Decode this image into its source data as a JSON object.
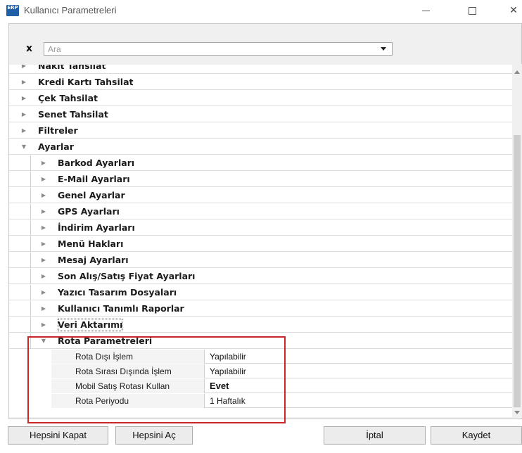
{
  "window": {
    "title": "Kullanıcı Parametreleri",
    "icon_name": "app-logo-icon",
    "icon_text": "ERP"
  },
  "filter": {
    "clear_symbol": "x",
    "search_placeholder": "Ara",
    "search_value": ""
  },
  "tree": {
    "top_items": [
      {
        "label": "Nakit Tahsilat",
        "expanded": false
      },
      {
        "label": "Kredi Kartı Tahsilat",
        "expanded": false
      },
      {
        "label": "Çek Tahsilat",
        "expanded": false
      },
      {
        "label": "Senet Tahsilat",
        "expanded": false
      },
      {
        "label": "Filtreler",
        "expanded": false
      },
      {
        "label": "Ayarlar",
        "expanded": true
      }
    ],
    "ayarlar_children": [
      {
        "label": "Barkod Ayarları"
      },
      {
        "label": "E-Mail Ayarları"
      },
      {
        "label": "Genel Ayarlar"
      },
      {
        "label": "GPS Ayarları"
      },
      {
        "label": "İndirim Ayarları"
      },
      {
        "label": "Menü Hakları"
      },
      {
        "label": "Mesaj Ayarları"
      },
      {
        "label": "Son Alış/Satış Fiyat Ayarları"
      },
      {
        "label": "Yazıcı Tasarım Dosyaları"
      },
      {
        "label": "Kullanıcı Tanımlı Raporlar"
      },
      {
        "label": "Veri Aktarımı"
      },
      {
        "label": "Rota Parametreleri",
        "expanded": true
      }
    ],
    "rota_params": [
      {
        "name": "Rota Dışı İşlem",
        "value": "Yapılabilir"
      },
      {
        "name": "Rota Sırası Dışında İşlem",
        "value": "Yapılabilir"
      },
      {
        "name": "Mobil Satış Rotası Kullan",
        "value": "Evet"
      },
      {
        "name": "Rota Periyodu",
        "value": "1 Haftalık"
      }
    ]
  },
  "buttons": {
    "close_all": "Hepsini Kapat",
    "open_all": "Hepsini Aç",
    "cancel": "İptal",
    "save": "Kaydet"
  },
  "colors": {
    "highlight": "#c8262b",
    "app_icon": "#1f5fa8"
  }
}
